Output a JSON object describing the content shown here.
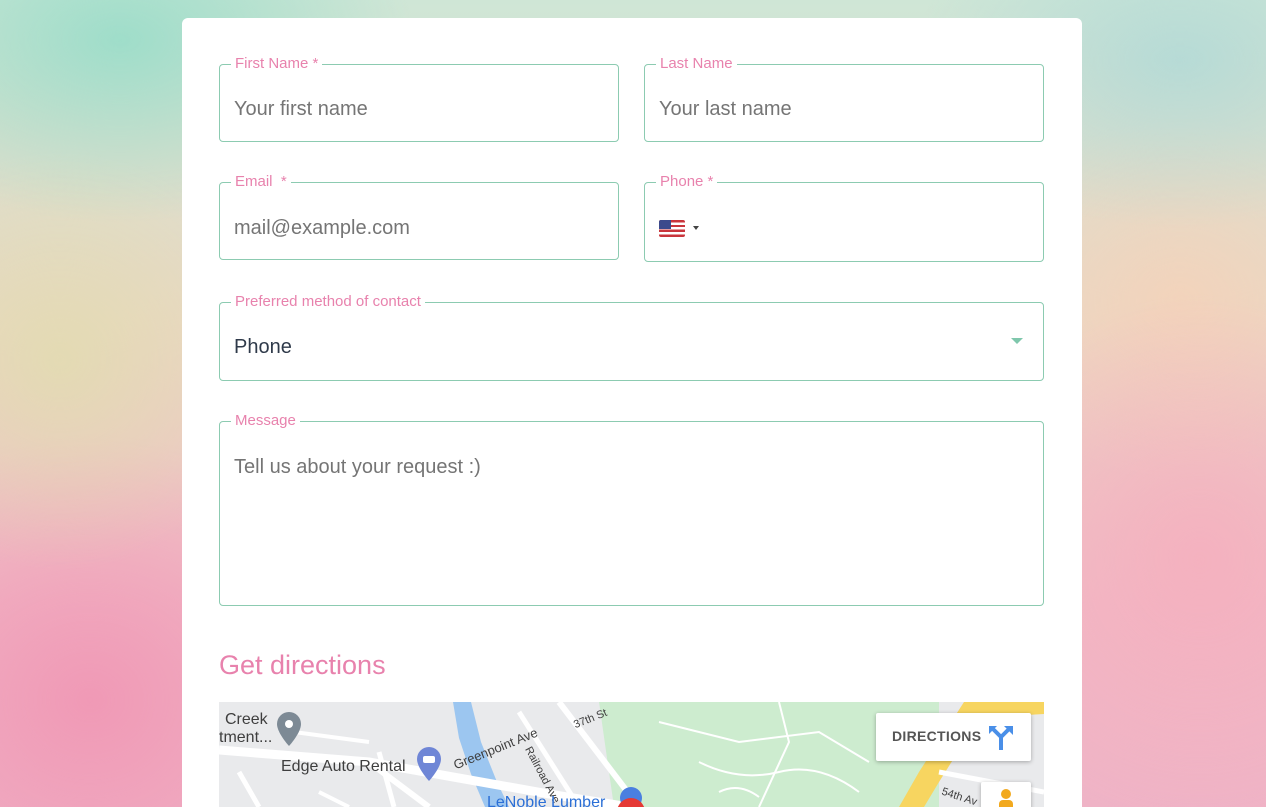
{
  "form": {
    "first_name": {
      "label": "First Name *",
      "placeholder": "Your first name"
    },
    "last_name": {
      "label": "Last Name",
      "placeholder": "Your last name"
    },
    "email": {
      "label": "Email  *",
      "placeholder": "mail@example.com"
    },
    "phone": {
      "label": "Phone *",
      "country_flag": "us-flag-icon"
    },
    "contact_method": {
      "label": "Preferred method of contact",
      "value": "Phone"
    },
    "message": {
      "label": "Message",
      "placeholder": "Tell us about your request :)"
    }
  },
  "directions": {
    "heading": "Get directions",
    "map": {
      "directions_button": "DIRECTIONS",
      "labels": {
        "creek": "Creek",
        "tment": "tment...",
        "edge_auto": "Edge Auto Rental",
        "greenpoint": "Greenpoint Ave",
        "railroad": "Railroad Ave",
        "st37": "37th St",
        "lenoble": "LeNoble Lumber",
        "ave54": "54th Av"
      }
    }
  },
  "colors": {
    "accent_pink": "#e882ad",
    "border_green": "#8ccbb1",
    "map_park": "#cdeccf",
    "map_road_yellow": "#f7d560"
  }
}
